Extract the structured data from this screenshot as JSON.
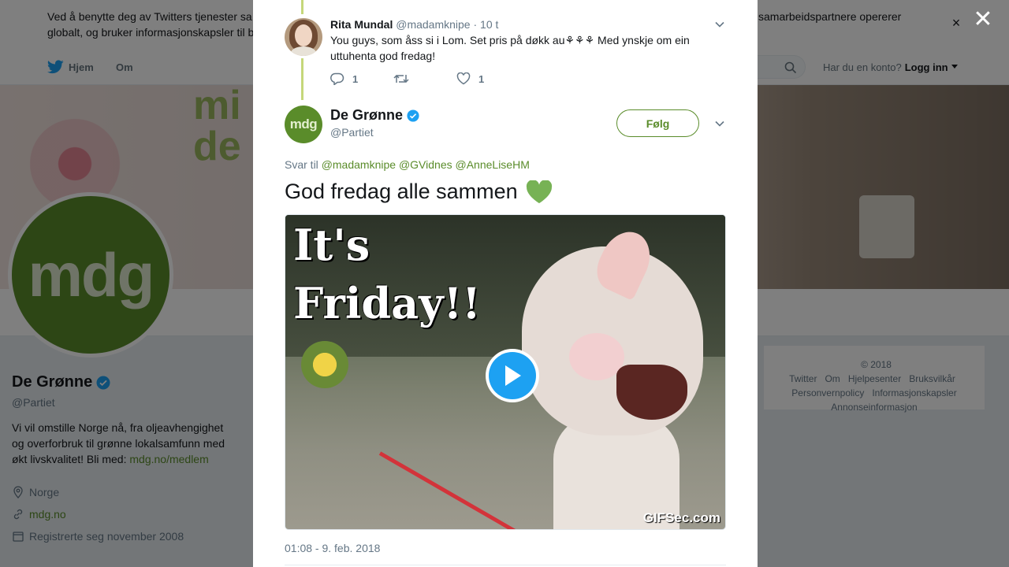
{
  "cookie_bar": {
    "line1": "Ved å benytte deg av Twitters tjenester sa",
    "line2": "globalt, og bruker informasjonskapsler til b",
    "right_text": "samarbeidspartnere opererer",
    "close": "×"
  },
  "nav": {
    "home": "Hjem",
    "about": "Om",
    "have_account": "Har du en konto?",
    "login": "Logg inn"
  },
  "banner": {
    "text_line1": "mi",
    "text_line2": "de"
  },
  "profile": {
    "avatar_text": "mdg",
    "name": "De Grønne",
    "handle": "@Partiet",
    "bio": "Vi vil omstille Norge nå, fra oljeavhengighet og overforbruk til grønne lokalsamfunn med økt livskvalitet! Bli med: ",
    "bio_link": "mdg.no/medlem",
    "location": "Norge",
    "website": "mdg.no",
    "joined": "Registrerte seg november 2008"
  },
  "footer": {
    "links": [
      "© 2018 Twitter",
      "Om",
      "Hjelpesenter",
      "Bruksvilkår",
      "Personvernpolicy",
      "Informasjonskapsler",
      "Annonseinformasjon"
    ]
  },
  "modal": {
    "close": "✕",
    "parent": {
      "name": "Rita Mundal",
      "handle": "@madamknipe",
      "time": "· 10 t",
      "text": "You guys, som åss si i Lom. Set pris på døkk au⚘⚘⚘ Med ynskje om ein uttuhenta god fredag!",
      "replies": "1",
      "likes": "1"
    },
    "tweet": {
      "avatar_text": "mdg",
      "name": "De Grønne",
      "handle": "@Partiet",
      "follow": "Følg",
      "reply_prefix": "Svar til",
      "reply_to": [
        "@madamknipe",
        "@GVidnes",
        "@AnneLiseHM"
      ],
      "text": "God fredag alle sammen",
      "media_text_1": "It's",
      "media_text_2": "Friday!!",
      "gif_label": "GIFSec.com",
      "timestamp": "01:08 - 9. feb. 2018"
    }
  },
  "colors": {
    "accent": "#5a8c2a",
    "twitter_blue": "#1da1f2",
    "muted": "#657786"
  }
}
